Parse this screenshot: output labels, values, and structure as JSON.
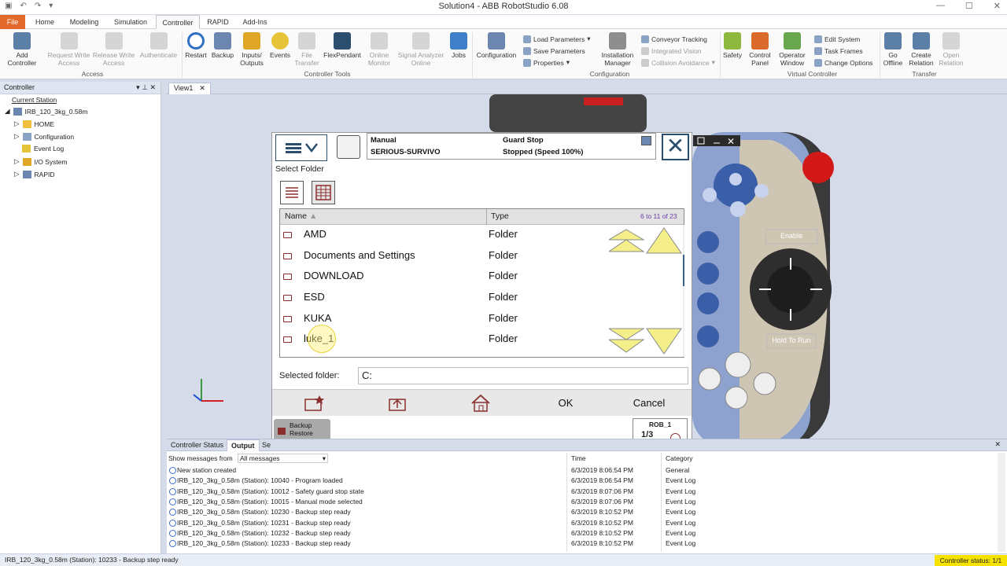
{
  "window": {
    "title": "Solution4 - ABB RobotStudio 6.08"
  },
  "tabs": [
    "File",
    "Home",
    "Modeling",
    "Simulation",
    "Controller",
    "RAPID",
    "Add-Ins"
  ],
  "ribbon": {
    "access": {
      "group": "Access",
      "add_controller": "Add Controller",
      "request_write": "Request Write Access",
      "release_write": "Release Write Access",
      "authenticate": "Authenticate"
    },
    "tools": {
      "group": "Controller Tools",
      "restart": "Restart",
      "backup": "Backup",
      "io": "Inputs/ Outputs",
      "events": "Events",
      "file_transfer": "File Transfer",
      "flexpendant": "FlexPendant",
      "online_monitor": "Online Monitor",
      "signal_analyzer": "Signal Analyzer Online",
      "jobs": "Jobs"
    },
    "config": {
      "group": "Configuration",
      "configuration": "Configuration",
      "load_params": "Load Parameters",
      "save_params": "Save Parameters",
      "properties": "Properties",
      "installation_manager": "Installation Manager",
      "conveyor": "Conveyor Tracking",
      "integrated_vision": "Integrated Vision",
      "collision": "Collision Avoidance"
    },
    "vc": {
      "group": "Virtual Controller",
      "safety": "Safety",
      "control_panel": "Control Panel",
      "operator_window": "Operator Window",
      "edit_system": "Edit System",
      "task_frames": "Task Frames",
      "change_options": "Change Options"
    },
    "transfer": {
      "group": "Transfer",
      "go_offline": "Go Offline",
      "create_relation": "Create Relation",
      "open_relation": "Open Relation"
    }
  },
  "left_panel": {
    "title": "Controller",
    "current_station": "Current Station",
    "tree": [
      "IRB_120_3kg_0.58m",
      "HOME",
      "Configuration",
      "Event Log",
      "I/O System",
      "RAPID"
    ]
  },
  "view_tab": "View1",
  "flexpendant": {
    "mode": "Manual",
    "controller": "SERIOUS-SURVIVO",
    "state": "Guard Stop",
    "speed": "Stopped (Speed 100%)",
    "heading": "Select Folder",
    "col_name": "Name",
    "col_type": "Type",
    "range": "6 to 11 of 23",
    "rows": [
      {
        "name": "AMD",
        "type": "Folder"
      },
      {
        "name": "Documents and Settings",
        "type": "Folder"
      },
      {
        "name": "DOWNLOAD",
        "type": "Folder"
      },
      {
        "name": "ESD",
        "type": "Folder"
      },
      {
        "name": "KUKA",
        "type": "Folder"
      },
      {
        "name": "luke_1",
        "type": "Folder"
      }
    ],
    "selected_label": "Selected folder:",
    "selected_value": "C:",
    "ok": "OK",
    "cancel": "Cancel",
    "backup_restore": "Backup Restore",
    "rob": "ROB_1",
    "rob_frac": "1/3",
    "enable": "Enable",
    "hold_to_run": "Hold To Run"
  },
  "output": {
    "tabs": [
      "Controller Status",
      "Output",
      "Se"
    ],
    "filter_label": "Show messages from",
    "filter_value": "All messages",
    "col_time": "Time",
    "col_category": "Category",
    "rows": [
      {
        "msg": "New station created",
        "time": "6/3/2019 8:06:54 PM",
        "cat": "General"
      },
      {
        "msg": "IRB_120_3kg_0.58m (Station): 10040 - Program loaded",
        "time": "6/3/2019 8:06:54 PM",
        "cat": "Event Log"
      },
      {
        "msg": "IRB_120_3kg_0.58m (Station): 10012 - Safety guard stop state",
        "time": "6/3/2019 8:07:06 PM",
        "cat": "Event Log"
      },
      {
        "msg": "IRB_120_3kg_0.58m (Station): 10015 - Manual mode selected",
        "time": "6/3/2019 8:07:06 PM",
        "cat": "Event Log"
      },
      {
        "msg": "IRB_120_3kg_0.58m (Station): 10230 - Backup step ready",
        "time": "6/3/2019 8:10:52 PM",
        "cat": "Event Log"
      },
      {
        "msg": "IRB_120_3kg_0.58m (Station): 10231 - Backup step ready",
        "time": "6/3/2019 8:10:52 PM",
        "cat": "Event Log"
      },
      {
        "msg": "IRB_120_3kg_0.58m (Station): 10232 - Backup step ready",
        "time": "6/3/2019 8:10:52 PM",
        "cat": "Event Log"
      },
      {
        "msg": "IRB_120_3kg_0.58m (Station): 10233 - Backup step ready",
        "time": "6/3/2019 8:10:52 PM",
        "cat": "Event Log"
      }
    ]
  },
  "statusbar": {
    "message": "IRB_120_3kg_0.58m (Station): 10233 - Backup step ready",
    "controller_status": "Controller status: 1/1"
  }
}
